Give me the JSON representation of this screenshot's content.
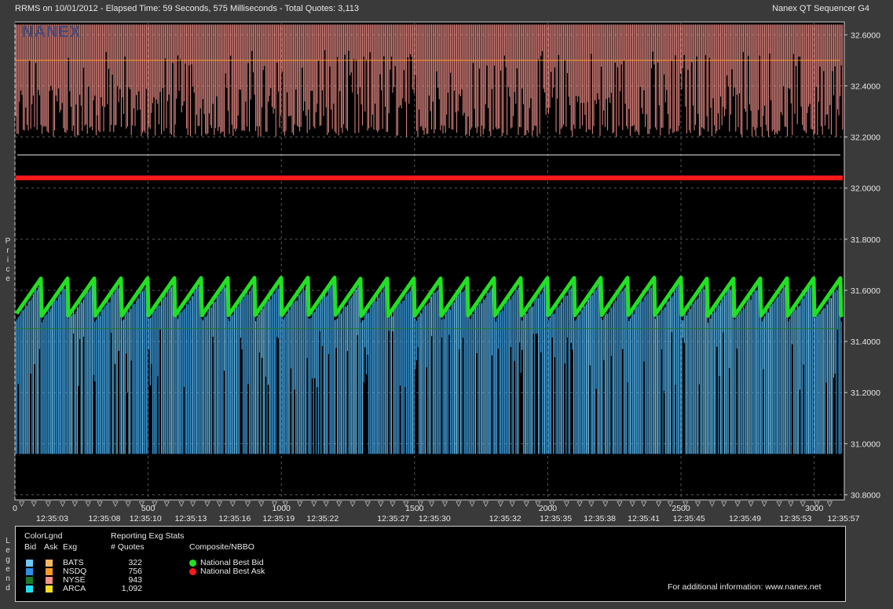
{
  "header": {
    "left": "RRMS on 10/01/2012  -  Elapsed Time: 59 Seconds, 575 Milliseconds  -  Total Quotes: 3,113",
    "right": "Nanex QT Sequencer G4",
    "watermark": "NANEX"
  },
  "y_axis_label": "Price",
  "legend_side_label": "Legend",
  "colors": {
    "ask_fill": "#f4928c",
    "bid_fill": "#3ea3e8",
    "nbb": "#22e022",
    "nba": "#ff1a1a",
    "grid": "#5a5a5a"
  },
  "chart_data": {
    "type": "line",
    "title": "",
    "xlabel": "",
    "ylabel": "Price",
    "xlim": [
      0,
      3113
    ],
    "ylim": [
      30.78,
      32.65
    ],
    "x_ticks": [
      0,
      500,
      1000,
      1500,
      2000,
      2500,
      3000
    ],
    "y_ticks": [
      "32.6000",
      "32.4000",
      "32.2000",
      "32.0000",
      "31.8000",
      "31.6000",
      "31.4000",
      "31.2000",
      "31.0000",
      "30.8000"
    ],
    "time_labels": [
      {
        "x": 140,
        "label": "12:35:03"
      },
      {
        "x": 336,
        "label": "12:35:08"
      },
      {
        "x": 490,
        "label": "12:35:10"
      },
      {
        "x": 660,
        "label": "12:35:13"
      },
      {
        "x": 825,
        "label": "12:35:16"
      },
      {
        "x": 990,
        "label": "12:35:19"
      },
      {
        "x": 1155,
        "label": "12:35:22"
      },
      {
        "x": 1420,
        "label": "12:35:27"
      },
      {
        "x": 1575,
        "label": "12:35:30"
      },
      {
        "x": 1840,
        "label": "12:35:32"
      },
      {
        "x": 2030,
        "label": "12:35:35"
      },
      {
        "x": 2195,
        "label": "12:35:38"
      },
      {
        "x": 2360,
        "label": "12:35:41"
      },
      {
        "x": 2530,
        "label": "12:35:45"
      },
      {
        "x": 2740,
        "label": "12:35:49"
      },
      {
        "x": 2930,
        "label": "12:35:53"
      },
      {
        "x": 3110,
        "label": "12:35:57"
      }
    ],
    "series": [
      {
        "name": "National Best Bid",
        "pattern": "sawtooth",
        "min": 31.5,
        "max": 31.65,
        "period_quotes": 100
      },
      {
        "name": "National Best Ask",
        "constant": 32.04
      },
      {
        "name": "Ask quotes",
        "range": [
          32.19,
          32.64
        ],
        "typical": 32.5
      },
      {
        "name": "Bid quotes",
        "range": [
          30.96,
          31.65
        ],
        "typical": 31.45
      }
    ]
  },
  "legend": {
    "color_legend_title": "ColorLgnd",
    "cols": {
      "bid": "Bid",
      "ask": "Ask",
      "exg": "Exg"
    },
    "stats_title": "Reporting Exg Stats",
    "quotes_col": "# Quotes",
    "composite_title": "Composite/NBBO",
    "exchanges": [
      {
        "name": "BATS",
        "quotes": "322",
        "bid_color": "#6ec8f5",
        "ask_color": "#f5b860"
      },
      {
        "name": "NSDQ",
        "quotes": "756",
        "bid_color": "#2f8fe6",
        "ask_color": "#f59a2a"
      },
      {
        "name": "NYSE",
        "quotes": "943",
        "bid_color": "#1e7a2a",
        "ask_color": "#f4928c"
      },
      {
        "name": "ARCA",
        "quotes": "1,092",
        "bid_color": "#20e0ee",
        "ask_color": "#f0e020"
      }
    ],
    "nbbo": [
      {
        "label": "National Best Bid",
        "color": "#22e022"
      },
      {
        "label": "National Best Ask",
        "color": "#ff1a1a"
      }
    ],
    "footer": "For additional information: www.nanex.net"
  }
}
